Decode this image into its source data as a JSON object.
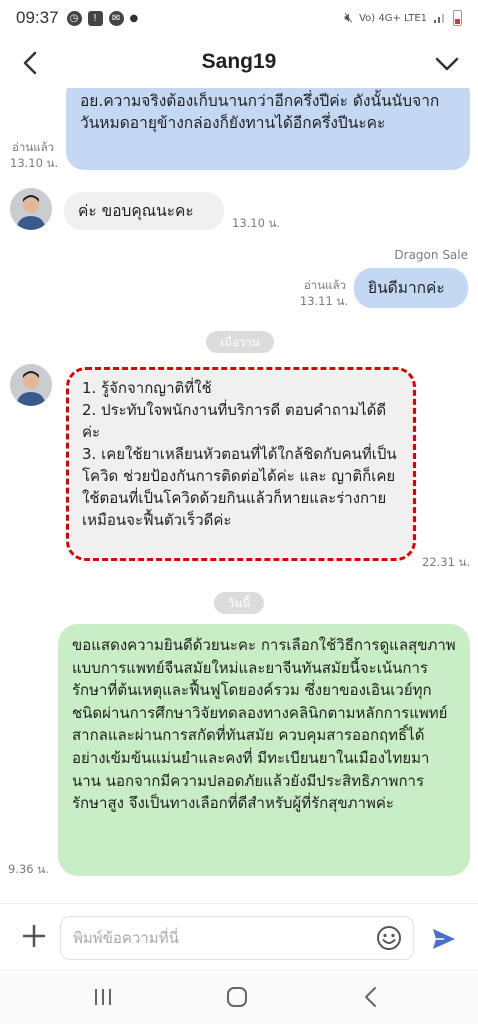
{
  "status_bar": {
    "time": "09:37",
    "network": "Vo) 4G+ LTE1"
  },
  "header": {
    "title": "Sang19"
  },
  "messages": {
    "m1": {
      "text": "อย.ความจริงต้องเก็บนานกว่าอีกครึ่งปีค่ะ ดังนั้นนับจากวันหมดอายุข้างกล่องก็ยังทานได้อีกครึ่งปีนะคะ",
      "read": "อ่านแล้ว",
      "time": "13.10 น."
    },
    "m2": {
      "text": "ค่ะ ขอบคุณนะคะ",
      "time": "13.10 น."
    },
    "m3": {
      "sender": "Dragon Sale",
      "text": "ยินดีมากค่ะ",
      "read": "อ่านแล้ว",
      "time": "13.11 น."
    },
    "day1": "เมื่อวาน",
    "m4": {
      "line1": "1. รู้จักจากญาติที่ใช้",
      "line2": "2. ประทับใจพนักงานที่บริการดี ตอบคำถามได้ดีค่ะ",
      "line3": "3. เคยใช้ยาเหลียนหัวตอนที่ได้ใกล้ชิดกับคนที่เป็นโควิด ช่วยป้องกันการติดต่อได้ค่ะ และ ญาติก็เคยใช้ตอนที่เป็นโควิดด้วยกินแล้วก็หายและร่างกายเหมือนจะฟื้นตัวเร็วดีค่ะ",
      "time": "22.31 น."
    },
    "day2": "วันนี้",
    "m5": {
      "text": "ขอแสดงความยินดีด้วยนะคะ การเลือกใช้วิธีการดูแลสุขภาพแบบการแพทย์จีนสมัยใหม่และยาจีนทันสมัยนี้จะเน้นการรักษาที่ต้นเหตุและฟื้นฟูโดยองค์รวม ซึ่งยาของเอินเวย์ทุกชนิดผ่านการศึกษาวิจัยทดลองทางคลินิกตามหลักการแพทย์สากลและผ่านการสกัดที่ทันสมัย ควบคุมสารออกฤทธิ์ได้อย่างเข้มข้นแม่นยำและคงที่ มีทะเบียนยาในเมืองไทยมานาน นอกจากมีความปลอดภัยแล้วยังมีประสิทธิภาพการรักษาสูง จึงเป็นทางเลือกที่ดีสำหรับผู้ที่รักสุขภาพค่ะ",
      "time": "9.36 น."
    }
  },
  "input": {
    "placeholder": "พิมพ์ข้อความที่นี่"
  },
  "colors": {
    "bubble_blue": "#c4d8f4",
    "bubble_gray": "#f0f0f0",
    "bubble_green": "#c9edc4",
    "highlight_dash": "#e00000",
    "send_icon": "#4a6fcf"
  }
}
